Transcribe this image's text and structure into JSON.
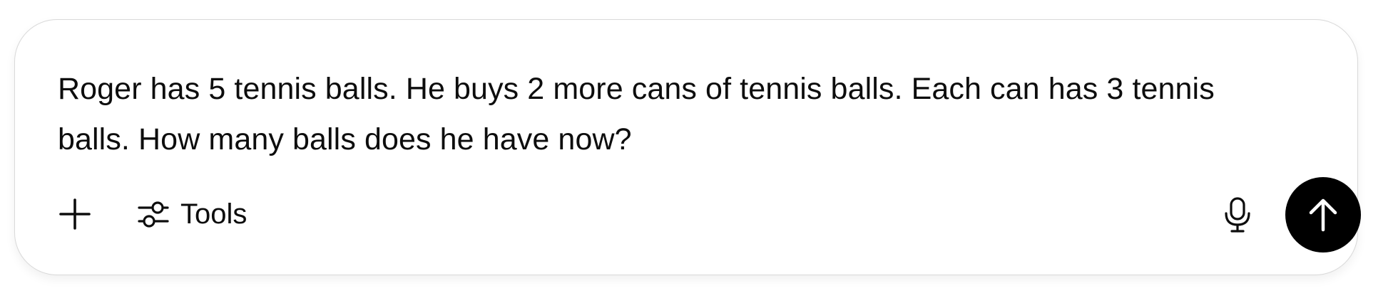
{
  "composer": {
    "prompt_text": "Roger has 5 tennis balls. He buys 2 more cans of tennis balls. Each can has 3 tennis balls. How many balls does he have now?",
    "toolbar": {
      "add_icon": "plus-icon",
      "tools_icon": "sliders-icon",
      "tools_label": "Tools",
      "mic_icon": "microphone-icon",
      "send_icon": "arrow-up-icon"
    },
    "colors": {
      "text": "#0d0d0d",
      "border": "#d9d9d9",
      "send_button_bg": "#000000",
      "send_icon": "#ffffff"
    }
  }
}
